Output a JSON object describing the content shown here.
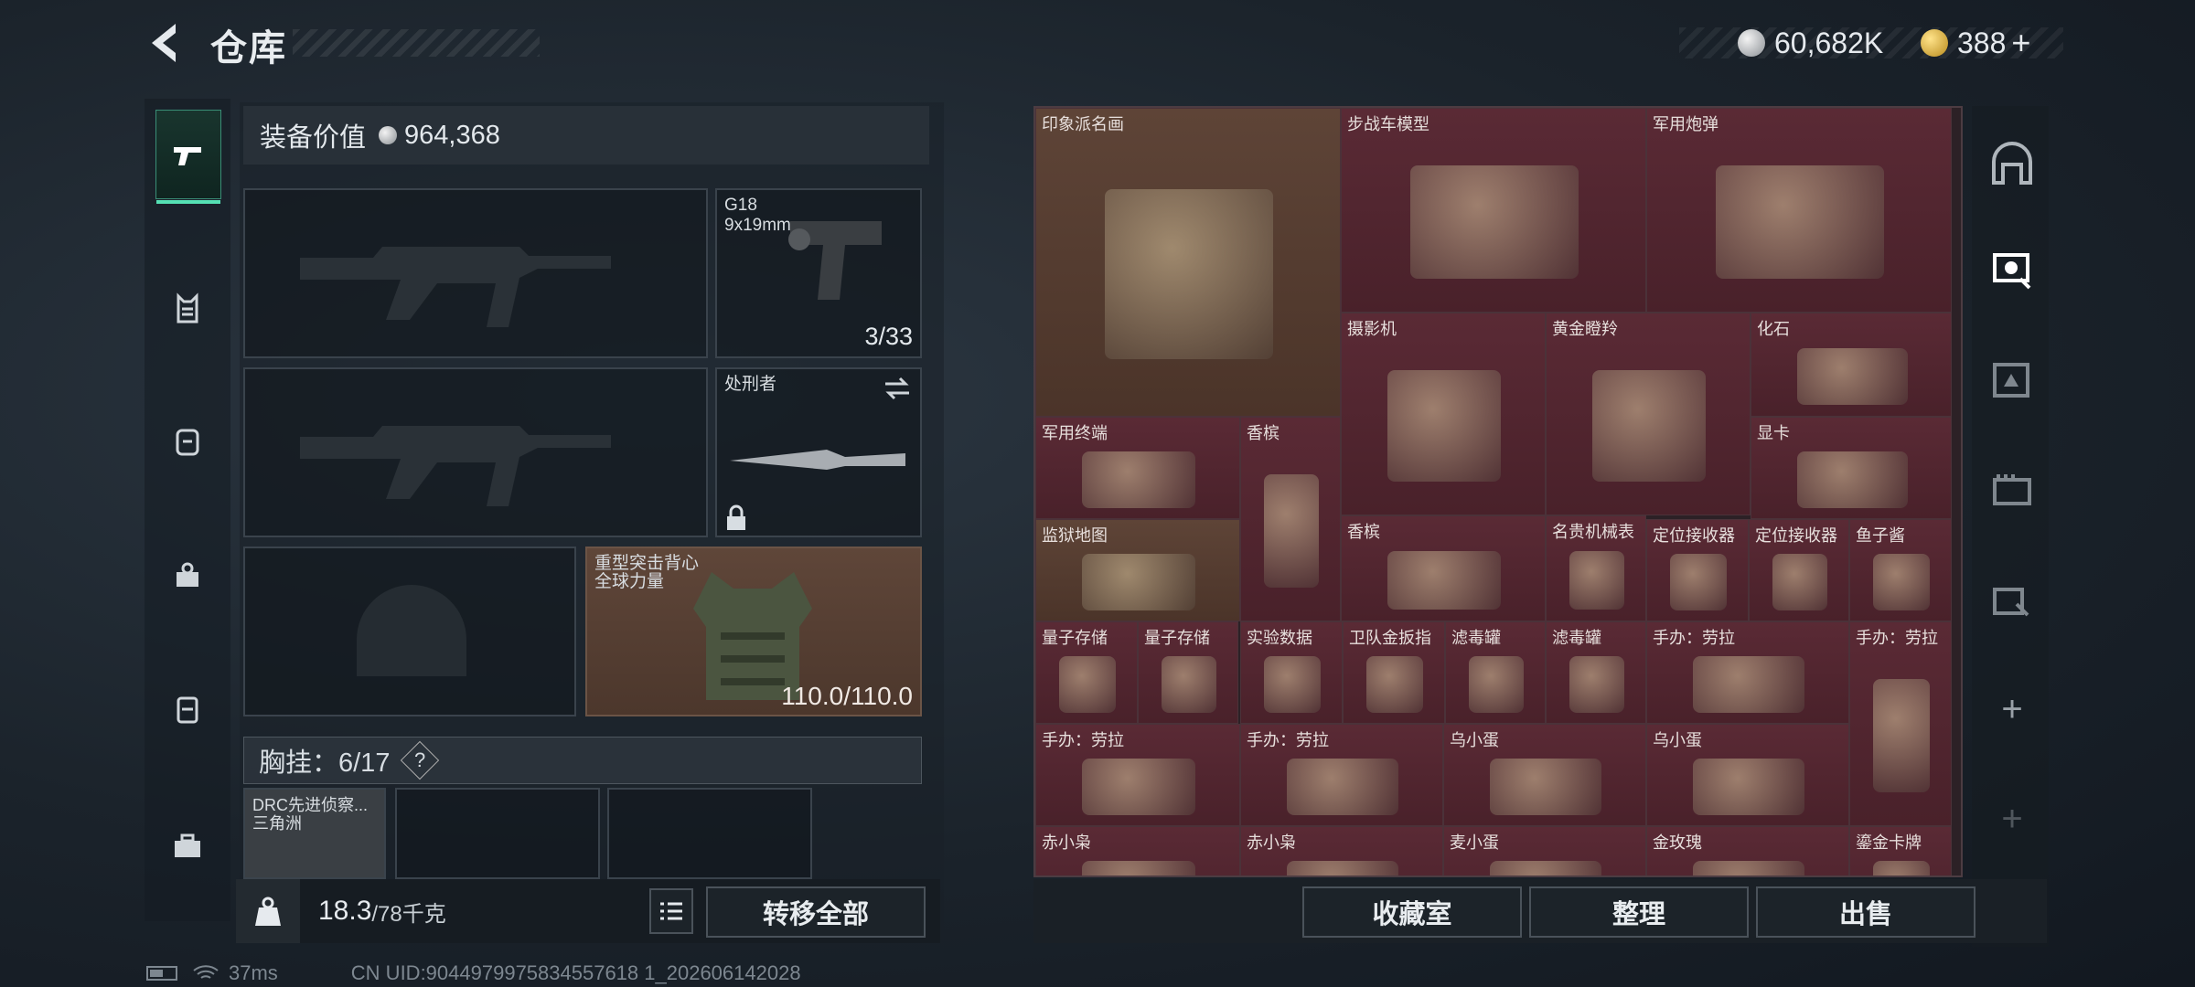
{
  "header": {
    "title": "仓库",
    "silver_amount": "60,682K",
    "gold_amount": "388",
    "gold_plus": "+"
  },
  "left_panel": {
    "equip_value_label": "装备价值",
    "equip_value": "964,368",
    "pistol": {
      "name": "G18",
      "caliber": "9x19mm",
      "ammo": "3/33"
    },
    "melee": {
      "name": "处刑者"
    },
    "armor": {
      "name": "重型突击背心",
      "sub": "全球力量",
      "durability": "110.0/110.0"
    },
    "chest_rig_label": "胸挂：6/17",
    "chest_rig_help": "?",
    "rig_item": {
      "name": "DRC先进侦察...",
      "sub": "三角洲"
    },
    "weight_value": "18.3",
    "weight_max": "/78千克",
    "transfer_all": "转移全部"
  },
  "stash_items": [
    {
      "label": "印象派名画"
    },
    {
      "label": "步战车模型"
    },
    {
      "label": "军用炮弹"
    },
    {
      "label": "摄影机"
    },
    {
      "label": "黄金瞪羚"
    },
    {
      "label": "化石"
    },
    {
      "label": "军用终端"
    },
    {
      "label": "香槟"
    },
    {
      "label": "显卡"
    },
    {
      "label": "监狱地图"
    },
    {
      "label": "香槟"
    },
    {
      "label": "名贵机械表"
    },
    {
      "label": "定位接收器"
    },
    {
      "label": "定位接收器"
    },
    {
      "label": "鱼子酱"
    },
    {
      "label": "量子存储"
    },
    {
      "label": "量子存储"
    },
    {
      "label": "实验数据"
    },
    {
      "label": "卫队金扳指"
    },
    {
      "label": "滤毒罐"
    },
    {
      "label": "滤毒罐"
    },
    {
      "label": "手办：劳拉"
    },
    {
      "label": "手办：劳拉"
    },
    {
      "label": "手办：劳拉"
    },
    {
      "label": "手办：劳拉"
    },
    {
      "label": "乌小蛋"
    },
    {
      "label": "乌小蛋"
    },
    {
      "label": "赤小枭"
    },
    {
      "label": "赤小枭"
    },
    {
      "label": "麦小蛋"
    },
    {
      "label": "金玫瑰"
    },
    {
      "label": "鎏金卡牌"
    }
  ],
  "bottom_buttons": {
    "collection": "收藏室",
    "sort": "整理",
    "sell": "出售"
  },
  "status": {
    "ping": "37ms",
    "uid": "CN UID:9044979975834557618 1_202606142028"
  },
  "colors": {
    "accent": "#55e0b4",
    "stash_red": "#5a2a35",
    "stash_brown": "#5e4437"
  }
}
